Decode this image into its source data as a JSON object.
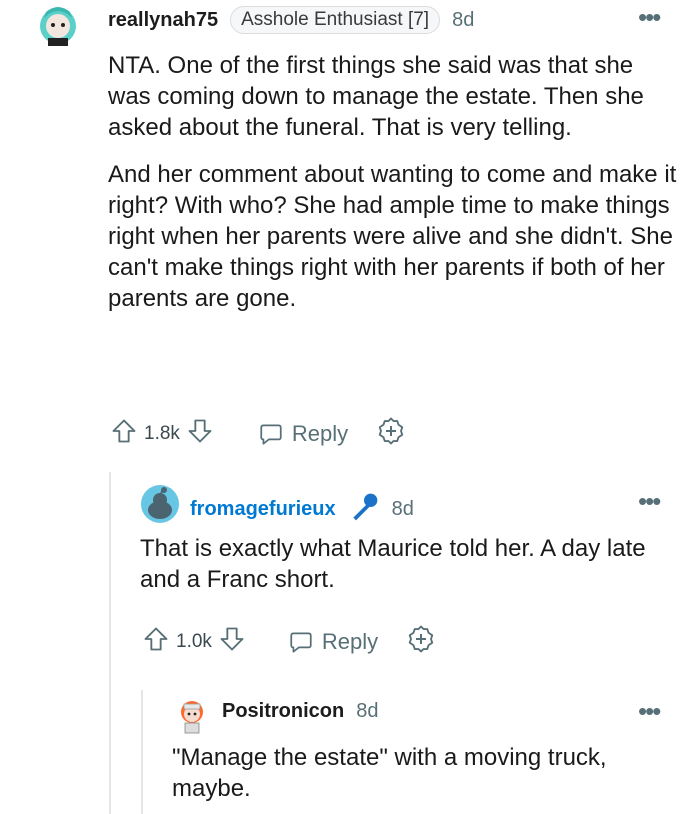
{
  "comments": [
    {
      "username": "reallynah75",
      "flair": "Asshole Enthusiast [7]",
      "age": "8d",
      "paragraphs": [
        "NTA. One of the first things she said was that she was coming down to manage the estate. Then she asked about the funeral. That is very telling.",
        "And her comment about wanting to come and make it right? With who? She had ample time to make things right when her parents were alive and she didn't. She can't make things right with her parents if both of her parents are gone."
      ],
      "votes": "1.8k",
      "reply_label": "Reply"
    },
    {
      "username": "fromagefurieux",
      "age": "8d",
      "paragraphs": [
        "That is exactly what Maurice told her. A day late and a Franc short."
      ],
      "votes": "1.0k",
      "reply_label": "Reply",
      "username_color": "#0079d3",
      "mic_color": "#1a73c9"
    },
    {
      "username": "Positronicon",
      "age": "8d",
      "paragraphs": [
        "\"Manage the estate\" with a moving truck, maybe."
      ]
    }
  ],
  "more_glyph": "•••"
}
